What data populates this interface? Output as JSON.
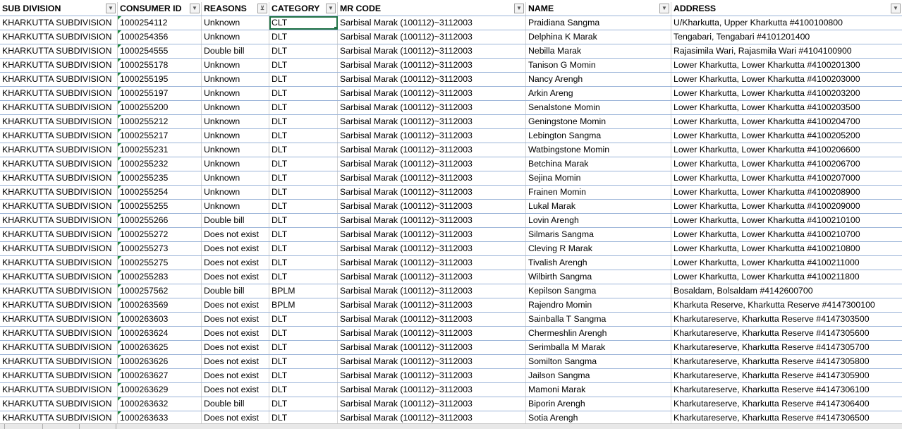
{
  "headers": [
    "SUB DIVISION",
    "CONSUMER ID",
    "REASONS",
    "CATEGORY",
    "MR CODE",
    "NAME",
    "ADDRESS"
  ],
  "filter_icons": [
    "dropdown-arrow",
    "dropdown-arrow",
    "filter-active",
    "dropdown-arrow",
    "dropdown-arrow",
    "dropdown-arrow",
    "dropdown-arrow"
  ],
  "selected_cell": {
    "row": 0,
    "column": "CATEGORY"
  },
  "colors": {
    "selection": "#217346",
    "gridline": "#9bb4d8",
    "error_triangle": "#1e8a3c"
  },
  "rows": [
    [
      "KHARKUTTA SUBDIVISION",
      "1000254112",
      "Unknown",
      "CLT",
      "Sarbisal Marak (100112)~3112003",
      "Praidiana Sangma",
      "U/Kharkutta, Upper Kharkutta #4100100800"
    ],
    [
      "KHARKUTTA SUBDIVISION",
      "1000254356",
      "Unknown",
      "DLT",
      "Sarbisal Marak (100112)~3112003",
      "Delphina K Marak",
      "Tengabari, Tengabari #4101201400"
    ],
    [
      "KHARKUTTA SUBDIVISION",
      "1000254555",
      "Double bill",
      "DLT",
      "Sarbisal Marak (100112)~3112003",
      "Nebilla Marak",
      "Rajasimila Wari, Rajasmila Wari #4104100900"
    ],
    [
      "KHARKUTTA SUBDIVISION",
      "1000255178",
      "Unknown",
      "DLT",
      "Sarbisal Marak (100112)~3112003",
      "Tanison G Momin",
      "Lower Kharkutta, Lower Kharkutta #4100201300"
    ],
    [
      "KHARKUTTA SUBDIVISION",
      "1000255195",
      "Unknown",
      "DLT",
      "Sarbisal Marak (100112)~3112003",
      "Nancy Arengh",
      "Lower Kharkutta, Lower Kharkutta #4100203000"
    ],
    [
      "KHARKUTTA SUBDIVISION",
      "1000255197",
      "Unknown",
      "DLT",
      "Sarbisal Marak (100112)~3112003",
      "Arkin Areng",
      "Lower Kharkutta, Lower Kharkutta #4100203200"
    ],
    [
      "KHARKUTTA SUBDIVISION",
      "1000255200",
      "Unknown",
      "DLT",
      "Sarbisal Marak (100112)~3112003",
      "Senalstone Momin",
      "Lower Kharkutta, Lower Kharkutta #4100203500"
    ],
    [
      "KHARKUTTA SUBDIVISION",
      "1000255212",
      "Unknown",
      "DLT",
      "Sarbisal Marak (100112)~3112003",
      "Geningstone Momin",
      "Lower Kharkutta, Lower Kharkutta #4100204700"
    ],
    [
      "KHARKUTTA SUBDIVISION",
      "1000255217",
      "Unknown",
      "DLT",
      "Sarbisal Marak (100112)~3112003",
      "Lebington Sangma",
      "Lower Kharkutta, Lower Kharkutta #4100205200"
    ],
    [
      "KHARKUTTA SUBDIVISION",
      "1000255231",
      "Unknown",
      "DLT",
      "Sarbisal Marak (100112)~3112003",
      "Watbingstone Momin",
      "Lower Kharkutta, Lower Kharkutta #4100206600"
    ],
    [
      "KHARKUTTA SUBDIVISION",
      "1000255232",
      "Unknown",
      "DLT",
      "Sarbisal Marak (100112)~3112003",
      "Betchina Marak",
      "Lower Kharkutta, Lower Kharkutta #4100206700"
    ],
    [
      "KHARKUTTA SUBDIVISION",
      "1000255235",
      "Unknown",
      "DLT",
      "Sarbisal Marak (100112)~3112003",
      "Sejina Momin",
      "Lower Kharkutta, Lower Kharkutta #4100207000"
    ],
    [
      "KHARKUTTA SUBDIVISION",
      "1000255254",
      "Unknown",
      "DLT",
      "Sarbisal Marak (100112)~3112003",
      "Frainen Momin",
      "Lower Kharkutta, Lower Kharkutta #4100208900"
    ],
    [
      "KHARKUTTA SUBDIVISION",
      "1000255255",
      "Unknown",
      "DLT",
      "Sarbisal Marak (100112)~3112003",
      "Lukal Marak",
      "Lower Kharkutta, Lower Kharkutta #4100209000"
    ],
    [
      "KHARKUTTA SUBDIVISION",
      "1000255266",
      "Double bill",
      "DLT",
      "Sarbisal Marak (100112)~3112003",
      "Lovin Arengh",
      "Lower Kharkutta, Lower Kharkutta #4100210100"
    ],
    [
      "KHARKUTTA SUBDIVISION",
      "1000255272",
      "Does not exist",
      "DLT",
      "Sarbisal Marak (100112)~3112003",
      "Silmaris Sangma",
      "Lower Kharkutta, Lower Kharkutta #4100210700"
    ],
    [
      "KHARKUTTA SUBDIVISION",
      "1000255273",
      "Does not exist",
      "DLT",
      "Sarbisal Marak (100112)~3112003",
      "Cleving R Marak",
      "Lower Kharkutta, Lower Kharkutta #4100210800"
    ],
    [
      "KHARKUTTA SUBDIVISION",
      "1000255275",
      "Does not exist",
      "DLT",
      "Sarbisal Marak (100112)~3112003",
      "Tivalish Arengh",
      "Lower Kharkutta, Lower Kharkutta #4100211000"
    ],
    [
      "KHARKUTTA SUBDIVISION",
      "1000255283",
      "Does not exist",
      "DLT",
      "Sarbisal Marak (100112)~3112003",
      "Wilbirth Sangma",
      "Lower Kharkutta, Lower Kharkutta #4100211800"
    ],
    [
      "KHARKUTTA SUBDIVISION",
      "1000257562",
      "Double bill",
      "BPLM",
      "Sarbisal Marak (100112)~3112003",
      "Kepilson Sangma",
      "Bosaldam, Bolsaldam #4142600700"
    ],
    [
      "KHARKUTTA SUBDIVISION",
      "1000263569",
      "Does not exist",
      "BPLM",
      "Sarbisal Marak (100112)~3112003",
      "Rajendro Momin",
      "Kharkuta Reserve, Kharkutta Reserve #4147300100"
    ],
    [
      "KHARKUTTA SUBDIVISION",
      "1000263603",
      "Does not exist",
      "DLT",
      "Sarbisal Marak (100112)~3112003",
      "Sainballa T Sangma",
      "Kharkutareserve, Kharkutta Reserve #4147303500"
    ],
    [
      "KHARKUTTA SUBDIVISION",
      "1000263624",
      "Does not exist",
      "DLT",
      "Sarbisal Marak (100112)~3112003",
      "Chermeshlin Arengh",
      "Kharkutareserve, Kharkutta Reserve #4147305600"
    ],
    [
      "KHARKUTTA SUBDIVISION",
      "1000263625",
      "Does not exist",
      "DLT",
      "Sarbisal Marak (100112)~3112003",
      "Serimballa M Marak",
      "Kharkutareserve, Kharkutta Reserve #4147305700"
    ],
    [
      "KHARKUTTA SUBDIVISION",
      "1000263626",
      "Does not exist",
      "DLT",
      "Sarbisal Marak (100112)~3112003",
      "Somilton Sangma",
      "Kharkutareserve, Kharkutta Reserve #4147305800"
    ],
    [
      "KHARKUTTA SUBDIVISION",
      "1000263627",
      "Does not exist",
      "DLT",
      "Sarbisal Marak (100112)~3112003",
      "Jailson Sangma",
      "Kharkutareserve, Kharkutta Reserve #4147305900"
    ],
    [
      "KHARKUTTA SUBDIVISION",
      "1000263629",
      "Does not exist",
      "DLT",
      "Sarbisal Marak (100112)~3112003",
      "Mamoni Marak",
      "Kharkutareserve, Kharkutta Reserve #4147306100"
    ],
    [
      "KHARKUTTA SUBDIVISION",
      "1000263632",
      "Double bill",
      "DLT",
      "Sarbisal Marak (100112)~3112003",
      "Biporin Arengh",
      "Kharkutareserve, Kharkutta Reserve #4147306400"
    ],
    [
      "KHARKUTTA SUBDIVISION",
      "1000263633",
      "Does not exist",
      "DLT",
      "Sarbisal Marak (100112)~3112003",
      "Sotia Arengh",
      "Kharkutareserve, Kharkutta Reserve #4147306500"
    ]
  ]
}
